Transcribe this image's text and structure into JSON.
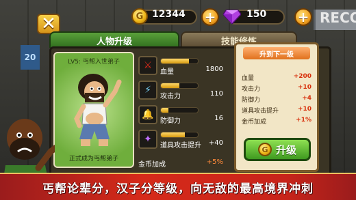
{
  "top_bar": {
    "coins": "12344",
    "gems": "150"
  },
  "tabs": [
    {
      "label": "人物升级",
      "active": true
    },
    {
      "label": "技能修炼",
      "active": false
    }
  ],
  "character": {
    "rank_top": "LV5: 丐帮入世弟子",
    "rank_bottom": "正式成为丐帮弟子"
  },
  "stats": [
    {
      "label": "血量",
      "value": "1800",
      "icon": "blood-icon",
      "fill": 0.75
    },
    {
      "label": "攻击力",
      "value": "110",
      "icon": "attack-icon",
      "fill": 0.5
    },
    {
      "label": "防御力",
      "value": "16",
      "icon": "defense-icon",
      "fill": 0.2
    },
    {
      "label": "道具攻击提升",
      "value": "+40",
      "icon": "item-attack-icon",
      "fill": 0.65
    }
  ],
  "gold_bonus": {
    "label": "金币加成",
    "value": "+5%"
  },
  "next_level": {
    "header": "升到下一级",
    "bonuses": [
      {
        "label": "血量",
        "value": "+200"
      },
      {
        "label": "攻击力",
        "value": "+10"
      },
      {
        "label": "防御力",
        "value": "+4"
      },
      {
        "label": "道具攻击提升",
        "value": "+10"
      },
      {
        "label": "金币加成",
        "value": "+1%"
      }
    ]
  },
  "upgrade_button": {
    "label": "升级"
  },
  "banner": {
    "text": "丐帮论辈分，汉子分等级，向无敌的最高境界冲刺"
  },
  "background": {
    "sign_right": "RECO",
    "sign_left": "20"
  },
  "colors": {
    "accent_green": "#3f9a20",
    "accent_gold": "#f0b818",
    "banner_red": "#d62a1a",
    "bonus_red": "#d8300c"
  }
}
